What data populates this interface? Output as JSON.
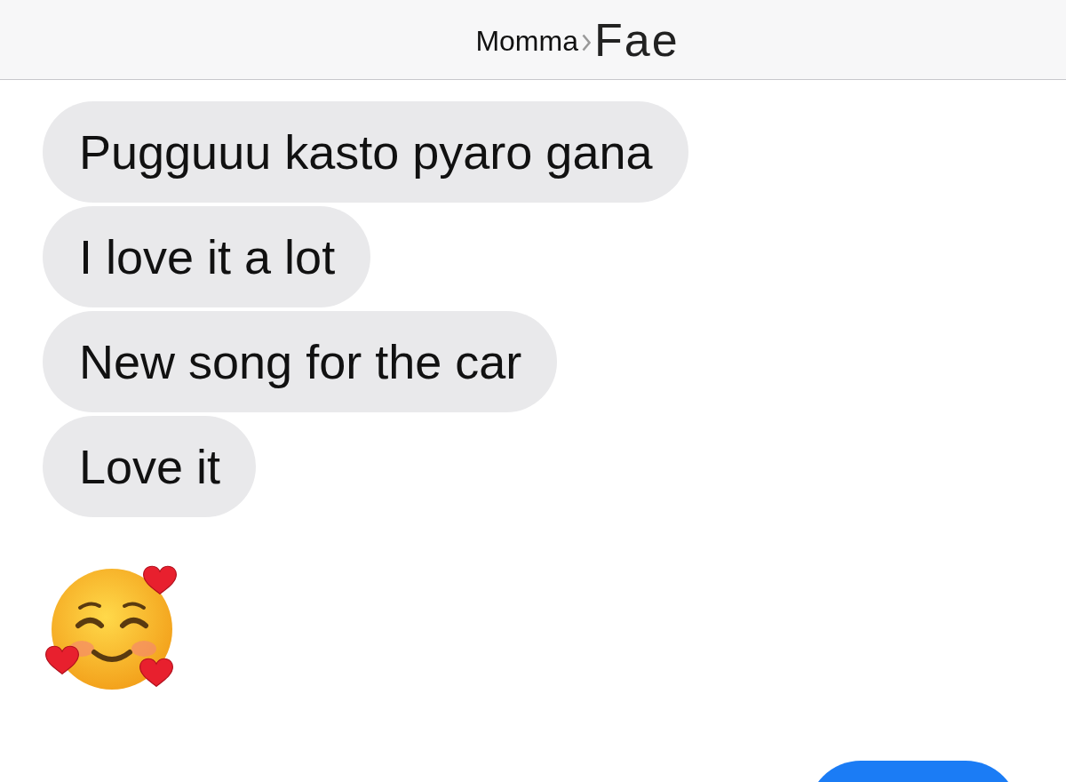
{
  "header": {
    "contact": "Momma",
    "overlay_text": "Fae"
  },
  "messages": [
    {
      "kind": "received",
      "text": "Pugguuu kasto pyaro gana"
    },
    {
      "kind": "received",
      "text": "I love it a lot"
    },
    {
      "kind": "received",
      "text": "New song for the car"
    },
    {
      "kind": "received",
      "text": "Love it"
    },
    {
      "kind": "emoji"
    },
    {
      "kind": "sent"
    }
  ]
}
